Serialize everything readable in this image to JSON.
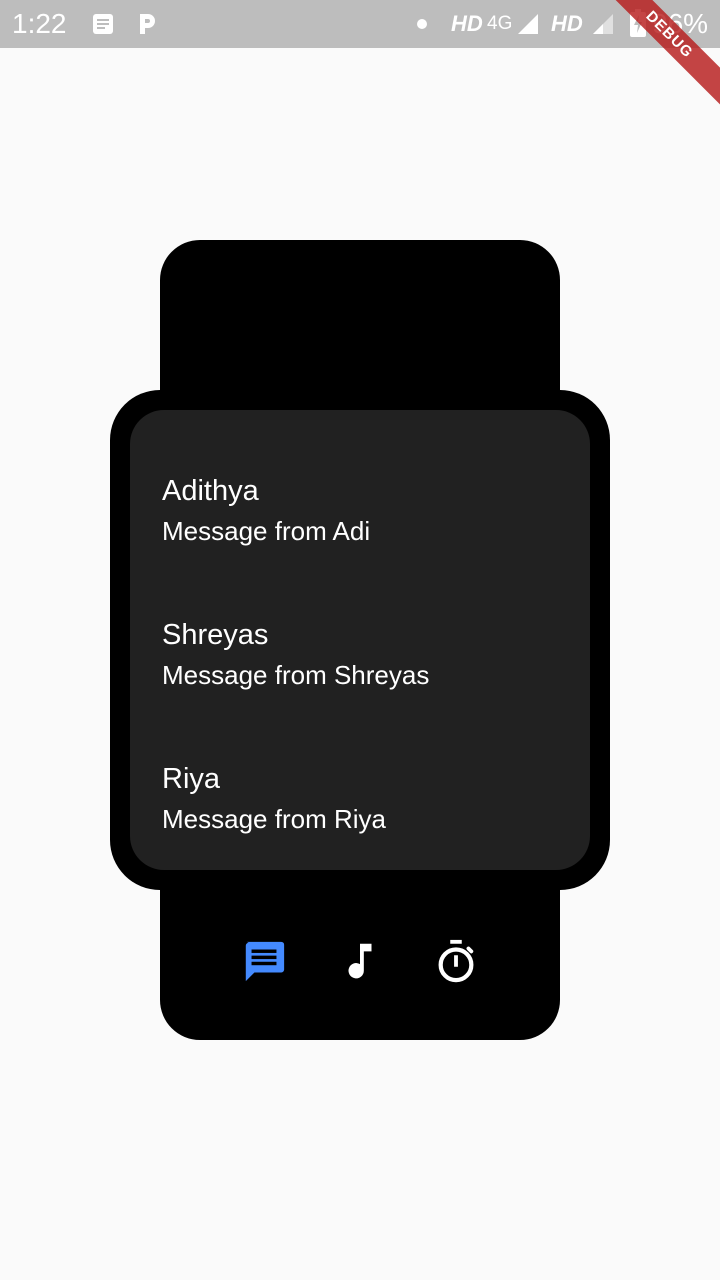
{
  "status_bar": {
    "time": "1:22",
    "hd_label_1": "HD",
    "network_label": "4G",
    "hd_label_2": "HD",
    "battery": "96%",
    "debug_label": "DEBUG",
    "icons": [
      "document-icon",
      "parking-icon",
      "dot-icon",
      "signal-icon",
      "signal-icon",
      "battery-charging-icon"
    ]
  },
  "messages": [
    {
      "name": "Adithya",
      "text": "Message from Adi"
    },
    {
      "name": "Shreyas",
      "text": "Message from Shreyas"
    },
    {
      "name": "Riya",
      "text": "Message from Riya"
    }
  ],
  "bottom_nav": [
    {
      "icon": "message-icon",
      "active": true
    },
    {
      "icon": "music-note-icon",
      "active": false
    },
    {
      "icon": "timer-icon",
      "active": false
    }
  ],
  "colors": {
    "status_bar": "#bdbdbd",
    "background": "#fafafa",
    "watch_body": "#000000",
    "watch_screen": "#212121",
    "accent": "#448aff",
    "debug_banner": "#b71c1c"
  }
}
